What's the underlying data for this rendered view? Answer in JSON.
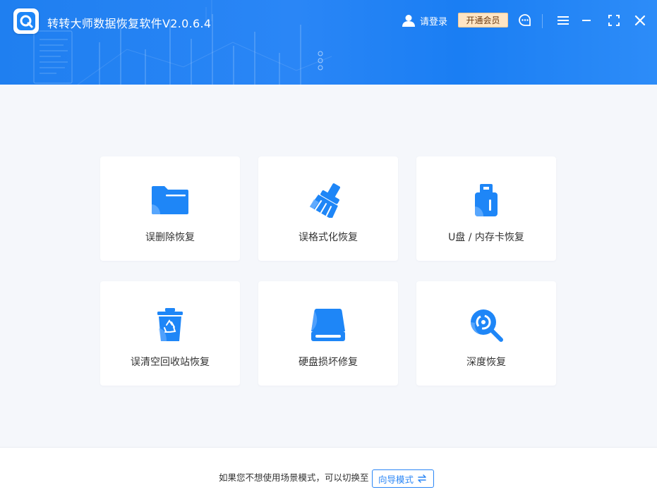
{
  "app": {
    "title": "转转大师数据恢复软件V2.0.6.4"
  },
  "header": {
    "login_label": "请登录",
    "vip_label": "开通会员"
  },
  "colors": {
    "primary": "#2a86f6",
    "vip_bg": "#ffe5c4",
    "background": "#f5f7fb"
  },
  "modes": [
    {
      "label": "误删除恢复",
      "icon": "folder-icon"
    },
    {
      "label": "误格式化恢复",
      "icon": "broom-icon"
    },
    {
      "label": "U盘 / 内存卡恢复",
      "icon": "usb-drive-icon"
    },
    {
      "label": "误清空回收站恢复",
      "icon": "recycle-bin-icon"
    },
    {
      "label": "硬盘损坏修复",
      "icon": "hard-disk-icon"
    },
    {
      "label": "深度恢复",
      "icon": "deep-scan-icon"
    }
  ],
  "footer": {
    "switch_text": "如果您不想使用场景模式，可以切换至",
    "wizard_label": "向导模式"
  }
}
